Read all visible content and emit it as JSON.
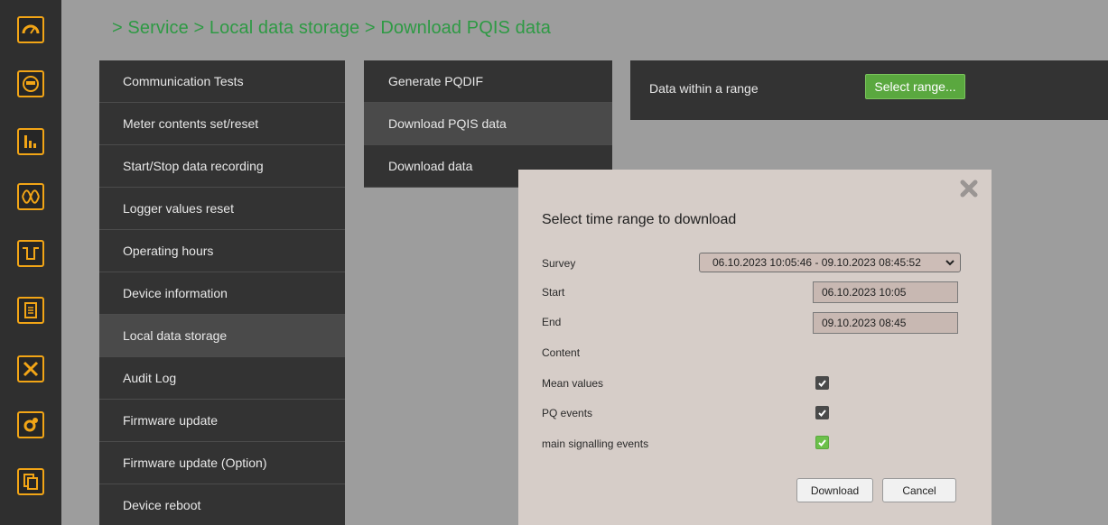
{
  "breadcrumb": "> Service > Local data storage > Download PQIS data",
  "rail_icons": [
    "gauge-icon",
    "meter-icon",
    "bar-chart-icon",
    "waveform-icon",
    "signal-step-icon",
    "document-list-icon",
    "tools-icon",
    "settings-gear-icon",
    "files-icon"
  ],
  "menu1": {
    "items": [
      {
        "label": "Communication Tests"
      },
      {
        "label": "Meter contents set/reset"
      },
      {
        "label": "Start/Stop data recording"
      },
      {
        "label": "Logger values reset"
      },
      {
        "label": "Operating hours"
      },
      {
        "label": "Device information"
      },
      {
        "label": "Local data storage",
        "active": true
      },
      {
        "label": "Audit Log"
      },
      {
        "label": "Firmware update"
      },
      {
        "label": "Firmware update (Option)"
      },
      {
        "label": "Device reboot"
      }
    ]
  },
  "menu2": {
    "items": [
      {
        "label": "Generate PQDIF"
      },
      {
        "label": "Download PQIS data",
        "active": true
      },
      {
        "label": "Download data"
      }
    ]
  },
  "range_panel": {
    "label": "Data within a range",
    "button": "Select range..."
  },
  "dialog": {
    "title": "Select time range to download",
    "survey_label": "Survey",
    "survey_value": "06.10.2023 10:05:46 - 09.10.2023 08:45:52",
    "start_label": "Start",
    "start_value": "06.10.2023 10:05",
    "end_label": "End",
    "end_value": "09.10.2023 08:45",
    "content_label": "Content",
    "mean_label": "Mean values",
    "pq_label": "PQ events",
    "main_label": "main signalling events",
    "download_button": "Download",
    "cancel_button": "Cancel",
    "mean_checked": true,
    "pq_checked": true,
    "main_checked": true
  },
  "colors": {
    "accent_orange": "#f2a516",
    "breadcrumb_green": "#2e9a44",
    "button_green": "#5aa83f"
  }
}
